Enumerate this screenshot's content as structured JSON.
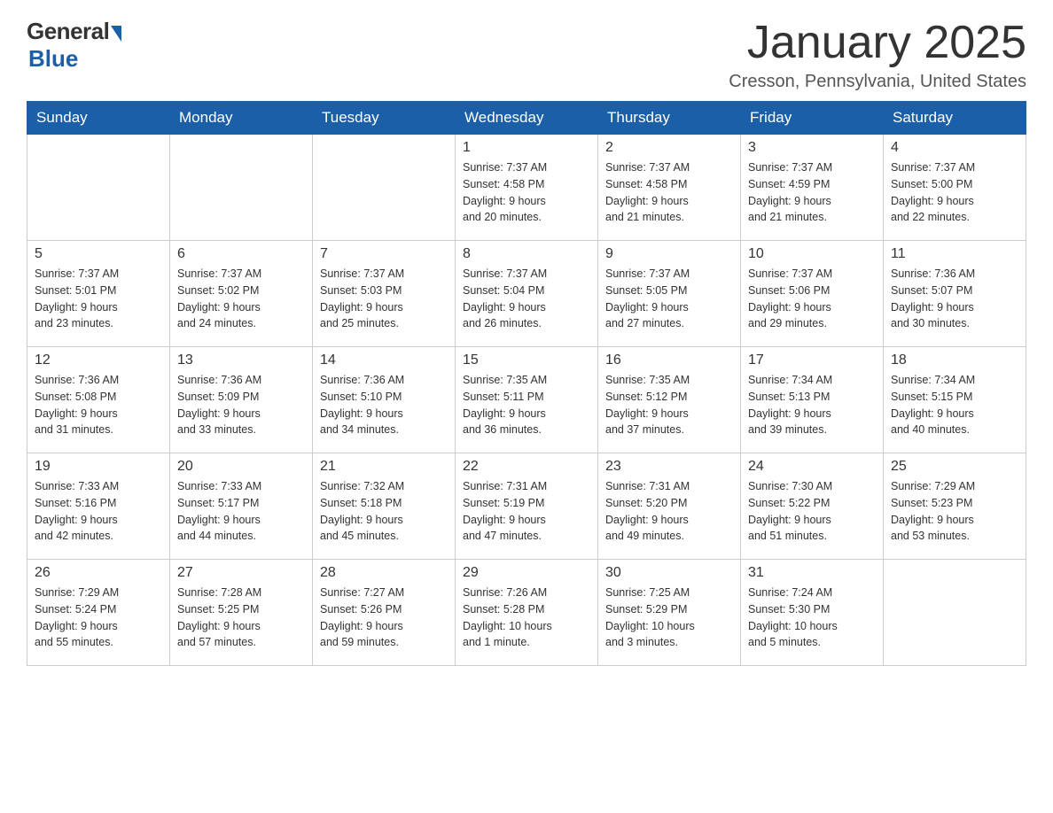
{
  "header": {
    "logo_general": "General",
    "logo_blue": "Blue",
    "title": "January 2025",
    "location": "Cresson, Pennsylvania, United States"
  },
  "weekdays": [
    "Sunday",
    "Monday",
    "Tuesday",
    "Wednesday",
    "Thursday",
    "Friday",
    "Saturday"
  ],
  "weeks": [
    [
      {
        "day": "",
        "info": ""
      },
      {
        "day": "",
        "info": ""
      },
      {
        "day": "",
        "info": ""
      },
      {
        "day": "1",
        "info": "Sunrise: 7:37 AM\nSunset: 4:58 PM\nDaylight: 9 hours\nand 20 minutes."
      },
      {
        "day": "2",
        "info": "Sunrise: 7:37 AM\nSunset: 4:58 PM\nDaylight: 9 hours\nand 21 minutes."
      },
      {
        "day": "3",
        "info": "Sunrise: 7:37 AM\nSunset: 4:59 PM\nDaylight: 9 hours\nand 21 minutes."
      },
      {
        "day": "4",
        "info": "Sunrise: 7:37 AM\nSunset: 5:00 PM\nDaylight: 9 hours\nand 22 minutes."
      }
    ],
    [
      {
        "day": "5",
        "info": "Sunrise: 7:37 AM\nSunset: 5:01 PM\nDaylight: 9 hours\nand 23 minutes."
      },
      {
        "day": "6",
        "info": "Sunrise: 7:37 AM\nSunset: 5:02 PM\nDaylight: 9 hours\nand 24 minutes."
      },
      {
        "day": "7",
        "info": "Sunrise: 7:37 AM\nSunset: 5:03 PM\nDaylight: 9 hours\nand 25 minutes."
      },
      {
        "day": "8",
        "info": "Sunrise: 7:37 AM\nSunset: 5:04 PM\nDaylight: 9 hours\nand 26 minutes."
      },
      {
        "day": "9",
        "info": "Sunrise: 7:37 AM\nSunset: 5:05 PM\nDaylight: 9 hours\nand 27 minutes."
      },
      {
        "day": "10",
        "info": "Sunrise: 7:37 AM\nSunset: 5:06 PM\nDaylight: 9 hours\nand 29 minutes."
      },
      {
        "day": "11",
        "info": "Sunrise: 7:36 AM\nSunset: 5:07 PM\nDaylight: 9 hours\nand 30 minutes."
      }
    ],
    [
      {
        "day": "12",
        "info": "Sunrise: 7:36 AM\nSunset: 5:08 PM\nDaylight: 9 hours\nand 31 minutes."
      },
      {
        "day": "13",
        "info": "Sunrise: 7:36 AM\nSunset: 5:09 PM\nDaylight: 9 hours\nand 33 minutes."
      },
      {
        "day": "14",
        "info": "Sunrise: 7:36 AM\nSunset: 5:10 PM\nDaylight: 9 hours\nand 34 minutes."
      },
      {
        "day": "15",
        "info": "Sunrise: 7:35 AM\nSunset: 5:11 PM\nDaylight: 9 hours\nand 36 minutes."
      },
      {
        "day": "16",
        "info": "Sunrise: 7:35 AM\nSunset: 5:12 PM\nDaylight: 9 hours\nand 37 minutes."
      },
      {
        "day": "17",
        "info": "Sunrise: 7:34 AM\nSunset: 5:13 PM\nDaylight: 9 hours\nand 39 minutes."
      },
      {
        "day": "18",
        "info": "Sunrise: 7:34 AM\nSunset: 5:15 PM\nDaylight: 9 hours\nand 40 minutes."
      }
    ],
    [
      {
        "day": "19",
        "info": "Sunrise: 7:33 AM\nSunset: 5:16 PM\nDaylight: 9 hours\nand 42 minutes."
      },
      {
        "day": "20",
        "info": "Sunrise: 7:33 AM\nSunset: 5:17 PM\nDaylight: 9 hours\nand 44 minutes."
      },
      {
        "day": "21",
        "info": "Sunrise: 7:32 AM\nSunset: 5:18 PM\nDaylight: 9 hours\nand 45 minutes."
      },
      {
        "day": "22",
        "info": "Sunrise: 7:31 AM\nSunset: 5:19 PM\nDaylight: 9 hours\nand 47 minutes."
      },
      {
        "day": "23",
        "info": "Sunrise: 7:31 AM\nSunset: 5:20 PM\nDaylight: 9 hours\nand 49 minutes."
      },
      {
        "day": "24",
        "info": "Sunrise: 7:30 AM\nSunset: 5:22 PM\nDaylight: 9 hours\nand 51 minutes."
      },
      {
        "day": "25",
        "info": "Sunrise: 7:29 AM\nSunset: 5:23 PM\nDaylight: 9 hours\nand 53 minutes."
      }
    ],
    [
      {
        "day": "26",
        "info": "Sunrise: 7:29 AM\nSunset: 5:24 PM\nDaylight: 9 hours\nand 55 minutes."
      },
      {
        "day": "27",
        "info": "Sunrise: 7:28 AM\nSunset: 5:25 PM\nDaylight: 9 hours\nand 57 minutes."
      },
      {
        "day": "28",
        "info": "Sunrise: 7:27 AM\nSunset: 5:26 PM\nDaylight: 9 hours\nand 59 minutes."
      },
      {
        "day": "29",
        "info": "Sunrise: 7:26 AM\nSunset: 5:28 PM\nDaylight: 10 hours\nand 1 minute."
      },
      {
        "day": "30",
        "info": "Sunrise: 7:25 AM\nSunset: 5:29 PM\nDaylight: 10 hours\nand 3 minutes."
      },
      {
        "day": "31",
        "info": "Sunrise: 7:24 AM\nSunset: 5:30 PM\nDaylight: 10 hours\nand 5 minutes."
      },
      {
        "day": "",
        "info": ""
      }
    ]
  ]
}
